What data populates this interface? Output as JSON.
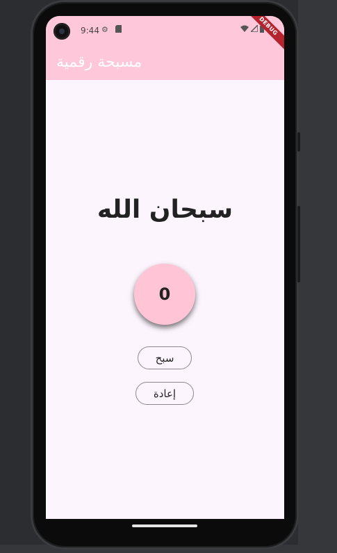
{
  "status_bar": {
    "time": "9:44",
    "icons": [
      "settings-icon",
      "sim-card-icon",
      "wifi-icon",
      "signal-icon",
      "battery-icon"
    ]
  },
  "app_bar": {
    "title": "مسبحة رقمية",
    "background": "#ffc8da"
  },
  "debug_banner": "DEBUG",
  "main": {
    "dhikr_text": "سبحان الله",
    "counter_value": "0",
    "tasbih_button": "سبح",
    "reset_button": "إعادة"
  },
  "colors": {
    "accent": "#ffc8da",
    "background": "#fdf5fd",
    "counter_fill": "#ffc4d6",
    "debug": "#b4232e"
  }
}
